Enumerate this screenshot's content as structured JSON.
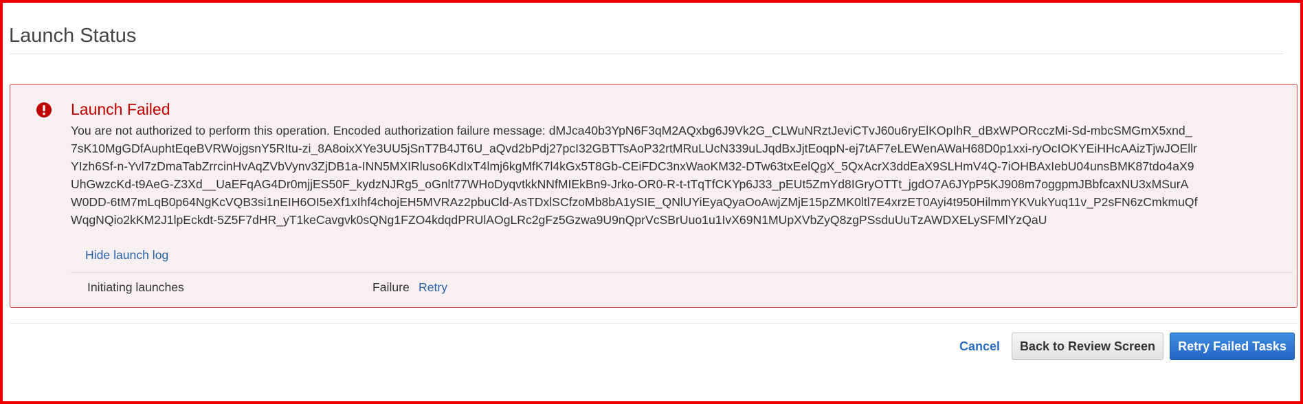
{
  "header": {
    "title": "Launch Status"
  },
  "alert": {
    "icon": "exclamation-circle-icon",
    "title": "Launch Failed",
    "message": "You are not authorized to perform this operation. Encoded authorization failure message: dMJca40b3YpN6F3qM2AQxbg6J9Vk2G_CLWuNRztJeviCTvJ60u6ryElKOpIhR_dBxWPORcczMi-Sd-mbcSMGmX5xnd_7sK10MgGDfAuphtEqeBVRWojgsnY5RItu-zi_8A8oixXYe3UU5jSnT7B4JT6U_aQvd2bPdj27pcI32GBTTsAoP32rtMRuLUcN339uLJqdBxJjtEoqpN-ej7tAF7eLEWenAWaH68D0p1xxi-ryOcIOKYEiHHcAAizTjwJOEllrYIzh6Sf-n-Yvl7zDmaTabZrrcinHvAqZVbVynv3ZjDB1a-INN5MXIRluso6KdIxT4lmj6kgMfK7l4kGx5T8Gb-CEiFDC3nxWaoKM32-DTw63txEelQgX_5QxAcrX3ddEaX9SLHmV4Q-7iOHBAxIebU04unsBMK87tdo4aX9UhGwzcKd-t9AeG-Z3Xd__UaEFqAG4Dr0mjjES50F_kydzNJRg5_oGnlt77WHoDyqvtkkNNfMIEkBn9-Jrko-OR0-R-t-tTqTfCKYp6J33_pEUt5ZmYd8IGryOTTt_jgdO7A6JYpP5KJ908m7oggpmJBbfcaxNU3xMSurAW0DD-6tM7mLqB0p64NgKcVQB3si1nEIH6OI5eXf1xIhf4chojEH5MVRAz2pbuCld-AsTDxlSCfzoMb8bA1ySIE_QNlUYiEyaQyaOoAwjZMjE15pZMK0ltl7E4xrzET0Ayi4t950HilmmYKVukYuq11v_P2sFN6zCmkmuQfWqgNQio2kKM2J1lpEckdt-5Z5F7dHR_yT1keCavgvk0sQNg1FZO4kdqdPRUlAOgLRc2gFz5Gzwa9U9nQprVcSBrUuo1u1IvX69N1MUpXVbZyQ8zgPSsduUuTzAWDXELySFMlYzQaU",
    "hide_log_label": "Hide launch log",
    "log": [
      {
        "name": "Initiating launches",
        "status": "Failure",
        "action": "Retry"
      }
    ]
  },
  "footer": {
    "cancel_label": "Cancel",
    "back_label": "Back to Review Screen",
    "retry_label": "Retry Failed Tasks"
  },
  "colors": {
    "accent_blue": "#2a6fc1",
    "error_red": "#c00000",
    "alert_border": "#c44a4a",
    "alert_background": "#f8f0f0",
    "frame_red": "#ee0000"
  }
}
